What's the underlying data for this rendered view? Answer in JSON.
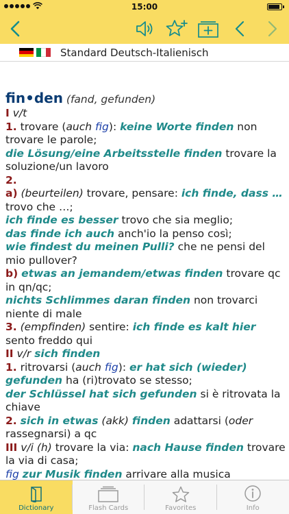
{
  "status_bar": {
    "time": "15:00",
    "battery_level": 0.9
  },
  "header": {
    "language_pair": "Standard Deutsch-Italienisch"
  },
  "entry": {
    "head_pre": "f",
    "head_stress": "i",
    "head_post": "n•den",
    "forms": "(fand, gefunden)",
    "s1": {
      "num": "I",
      "gram": "v/t"
    },
    "s1_1": {
      "num": "1.",
      "t1": "trovare (",
      "auch": "auch",
      "fig": "fig",
      "t2": "): ",
      "ex1": "keine Worte finden",
      "t3": " non trovare le parole;",
      "ex2": "die Lösung/eine Arbeitsstelle finden",
      "t4": " trovare la soluzione/un lavoro"
    },
    "s1_2": {
      "num": "2."
    },
    "s1_2a": {
      "num": "a)",
      "gram": "(beurteilen)",
      "t1": " trovare, pensare: ",
      "ex1": "ich finde, dass …",
      "t2": " trovo che …;",
      "ex2": "ich finde es besser",
      "t3": " trovo che sia meglio;",
      "ex3": "das finde ich auch",
      "t4": " anch'io la penso così;",
      "ex4": "wie findest du meinen Pulli?",
      "t5": " che ne pensi del mio pullover?"
    },
    "s1_2b": {
      "num": "b)",
      "ex1": "etwas an jemandem/etwas finden",
      "t1": " trovare qc in qn/qc;",
      "ex2": "nichts Schlimmes daran finden",
      "t2": " non trovarci niente di male"
    },
    "s1_3": {
      "num": "3.",
      "gram": "(empfinden)",
      "t1": " sentire: ",
      "ex1": "ich finde es kalt hier",
      "t2": " sento freddo qui"
    },
    "s2": {
      "num": "II",
      "gram": "v/r",
      "ex": "sich finden"
    },
    "s2_1": {
      "num": "1.",
      "t1": " ritrovarsi (",
      "auch": "auch",
      "fig": "fig",
      "t2": "): ",
      "ex1": "er hat sich (wieder) gefunden",
      "t3": " ha (ri)trovato se stesso;",
      "ex2": "der Schlüssel hat sich gefunden",
      "t4": " si è ritrovata la chiave"
    },
    "s2_2": {
      "num": "2.",
      "ex1": "sich in etwas",
      "gram1": "(akk)",
      "ex2": "finden",
      "t1": " adattarsi (",
      "oder": "oder",
      "t2": " rassegnarsi) a qc"
    },
    "s3": {
      "num": "III",
      "gram": "v/i (h)",
      "t1": " trovare la via: ",
      "ex1": "nach Hause finden",
      "t2": " trovare la via di casa;",
      "fig": "fig",
      "ex2": "zur Musik finden",
      "t3": " arrivare alla musica"
    }
  },
  "tabs": [
    {
      "label": "Dictionary",
      "icon": "book-icon"
    },
    {
      "label": "Flash Cards",
      "icon": "cards-icon"
    },
    {
      "label": "Favorites",
      "icon": "star-icon"
    },
    {
      "label": "Info",
      "icon": "info-icon"
    }
  ],
  "colors": {
    "bar": "#f9dc62",
    "icon": "#148c8c",
    "headword": "#0b3c73",
    "sense_number": "#8b1a1a",
    "example": "#1f8a8a",
    "label": "#1a3ea8"
  }
}
